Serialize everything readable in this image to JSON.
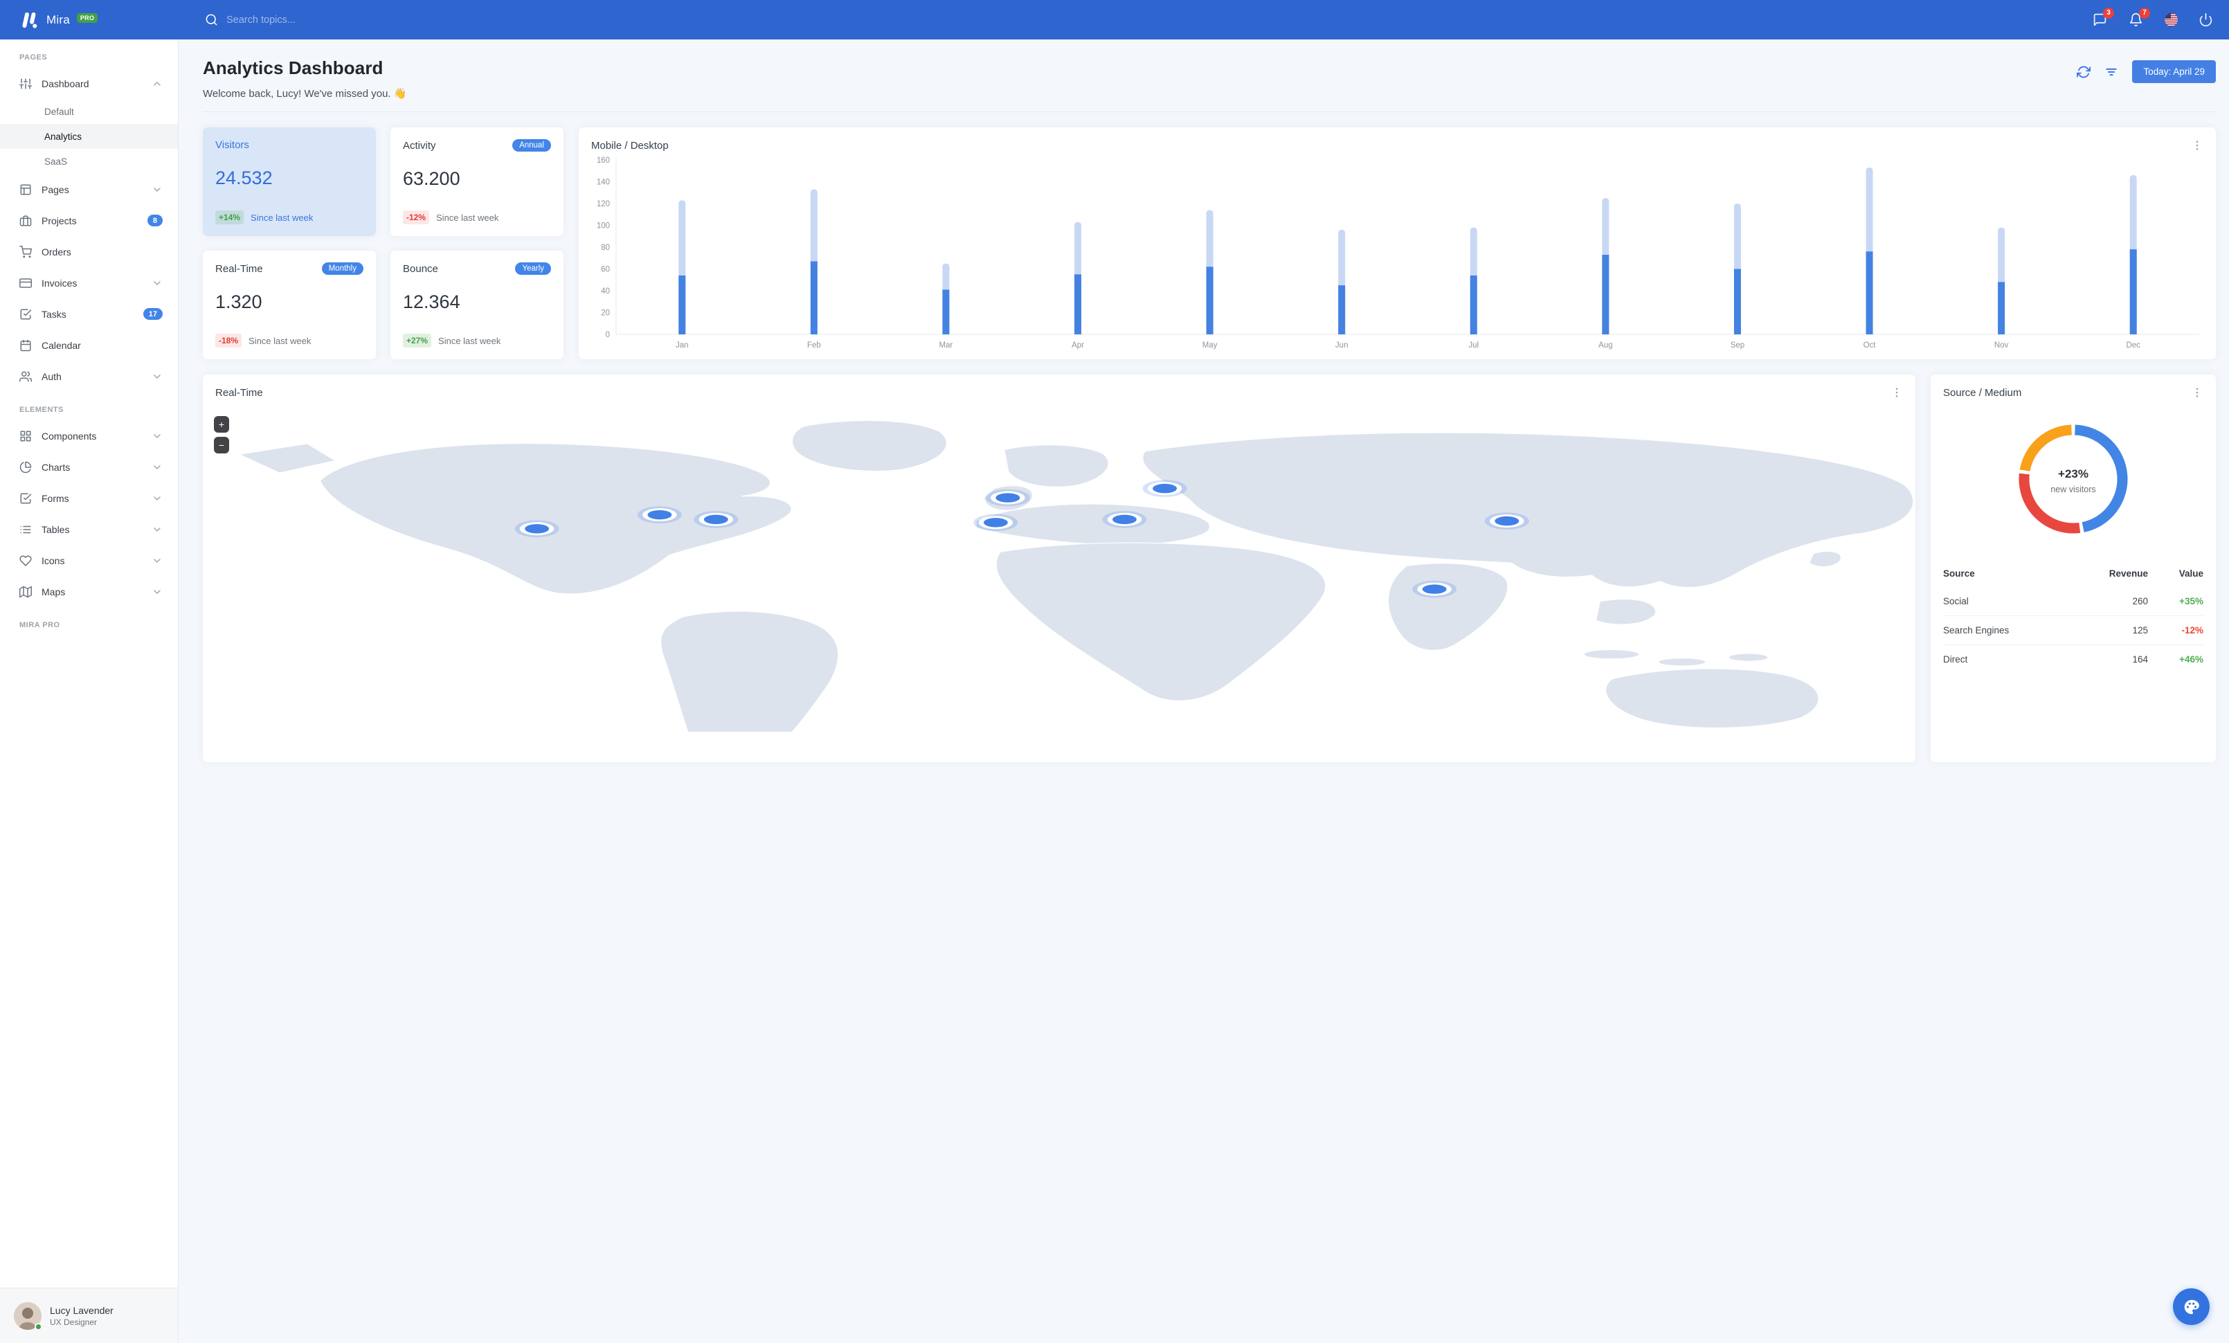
{
  "navbar": {
    "logo_text": "Mira",
    "logo_badge": "PRO",
    "search_placeholder": "Search topics...",
    "messages_badge": "3",
    "notifications_badge": "7"
  },
  "sidebar": {
    "sections": [
      {
        "label": "PAGES",
        "items": [
          {
            "label": "Dashboard",
            "icon": "sliders",
            "chevron": "up",
            "children": [
              {
                "label": "Default",
                "active": false
              },
              {
                "label": "Analytics",
                "active": true
              },
              {
                "label": "SaaS",
                "active": false
              }
            ]
          },
          {
            "label": "Pages",
            "icon": "layout",
            "chevron": "down"
          },
          {
            "label": "Projects",
            "icon": "briefcase",
            "badge": "8"
          },
          {
            "label": "Orders",
            "icon": "shopping-cart"
          },
          {
            "label": "Invoices",
            "icon": "credit-card",
            "chevron": "down"
          },
          {
            "label": "Tasks",
            "icon": "check-square",
            "badge": "17"
          },
          {
            "label": "Calendar",
            "icon": "calendar"
          },
          {
            "label": "Auth",
            "icon": "users",
            "chevron": "down"
          }
        ]
      },
      {
        "label": "ELEMENTS",
        "items": [
          {
            "label": "Components",
            "icon": "grid",
            "chevron": "down"
          },
          {
            "label": "Charts",
            "icon": "pie-chart",
            "chevron": "down"
          },
          {
            "label": "Forms",
            "icon": "check-square",
            "chevron": "down"
          },
          {
            "label": "Tables",
            "icon": "list",
            "chevron": "down"
          },
          {
            "label": "Icons",
            "icon": "heart",
            "chevron": "down"
          },
          {
            "label": "Maps",
            "icon": "map",
            "chevron": "down"
          }
        ]
      },
      {
        "label": "MIRA PRO",
        "items": []
      }
    ],
    "user": {
      "name": "Lucy Lavender",
      "role": "UX Designer",
      "status": "online"
    }
  },
  "header": {
    "title": "Analytics Dashboard",
    "subtitle": "Welcome back, Lucy! We've missed you. 👋",
    "date_button_label": "Today: April 29"
  },
  "stats": [
    {
      "title": "Visitors",
      "value": "24.532",
      "delta": "+14%",
      "delta_type": "positive",
      "note": "Since last week",
      "highlight": true
    },
    {
      "title": "Activity",
      "value": "63.200",
      "delta": "-12%",
      "delta_type": "negative",
      "note": "Since last week",
      "badge": "Annual"
    },
    {
      "title": "Real-Time",
      "value": "1.320",
      "delta": "-18%",
      "delta_type": "negative",
      "note": "Since last week",
      "badge": "Monthly"
    },
    {
      "title": "Bounce",
      "value": "12.364",
      "delta": "+27%",
      "delta_type": "positive",
      "note": "Since last week",
      "badge": "Yearly"
    }
  ],
  "chart_data": [
    {
      "type": "bar",
      "title": "Mobile / Desktop",
      "stacked": true,
      "categories": [
        "Jan",
        "Feb",
        "Mar",
        "Apr",
        "May",
        "Jun",
        "Jul",
        "Aug",
        "Sep",
        "Oct",
        "Nov",
        "Dec"
      ],
      "series": [
        {
          "name": "Mobile",
          "color": "#4382e1",
          "values": [
            54,
            67,
            41,
            55,
            62,
            45,
            54,
            73,
            60,
            76,
            48,
            78
          ]
        },
        {
          "name": "Desktop",
          "color": "#c8d8f4",
          "values": [
            69,
            66,
            24,
            48,
            52,
            51,
            44,
            52,
            60,
            77,
            50,
            68
          ]
        }
      ],
      "ylim": [
        0,
        160
      ],
      "ytick_step": 20,
      "grid": false,
      "legend": "none"
    },
    {
      "type": "pie",
      "title": "Source / Medium",
      "donut": true,
      "center_value": "+23%",
      "center_label": "new visitors",
      "segments": [
        {
          "label": "Social",
          "value": 260,
          "color": "#4285e4"
        },
        {
          "label": "Direct",
          "value": 164,
          "color": "#e8473f"
        },
        {
          "label": "Search Engines",
          "value": 125,
          "color": "#f9a11b"
        }
      ]
    }
  ],
  "map": {
    "title": "Real-Time",
    "zoom_in_label": "+",
    "zoom_out_label": "−",
    "marker_color": "#4180e6",
    "markers": [
      [
        166,
        158
      ],
      [
        227,
        140
      ],
      [
        255,
        146
      ],
      [
        400,
        118
      ],
      [
        478,
        106
      ],
      [
        394,
        150
      ],
      [
        458,
        146
      ],
      [
        612,
        236
      ],
      [
        648,
        148
      ]
    ]
  },
  "source_medium": {
    "title": "Source / Medium",
    "table": {
      "headers": [
        "Source",
        "Revenue",
        "Value"
      ],
      "rows": [
        {
          "source": "Social",
          "revenue": "260",
          "value": "+35%",
          "value_type": "positive"
        },
        {
          "source": "Search Engines",
          "revenue": "125",
          "value": "-12%",
          "value_type": "negative"
        },
        {
          "source": "Direct",
          "revenue": "164",
          "value": "+46%",
          "value_type": "positive"
        }
      ]
    }
  },
  "colors": {
    "navbar": "#2e65cf",
    "primary": "#4285e8",
    "positive": "#43a047",
    "negative": "#e53935",
    "highlight_card_bg": "#d9e6f8",
    "map_land": "#dde3ed"
  }
}
